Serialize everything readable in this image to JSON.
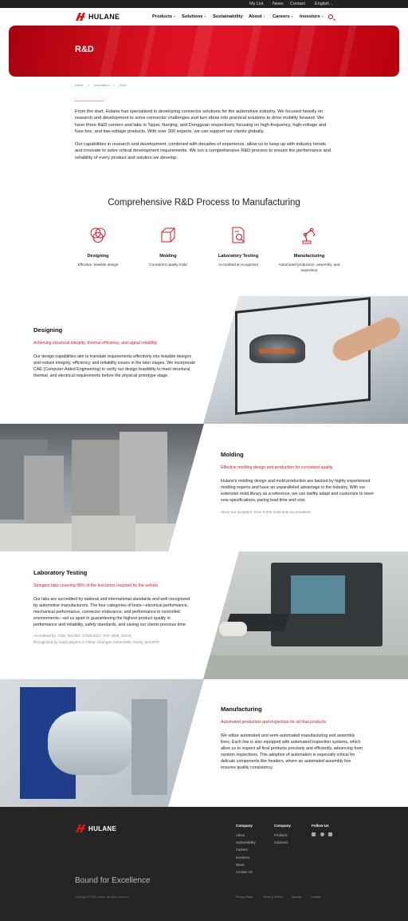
{
  "topbar": {
    "my_list": "My List",
    "news": "News",
    "contact": "Contact",
    "language": "English"
  },
  "header": {
    "logo": "HULANE",
    "nav": [
      "Products",
      "Solutions",
      "Sustainability",
      "About",
      "Careers",
      "Investors"
    ]
  },
  "hero": {
    "title": "R&D"
  },
  "breadcrumb": [
    "Home",
    "Innovation",
    "R&D"
  ],
  "intro": {
    "p1": "From the start, Hulane has specialized in developing connector solutions for the automotive industry. We focused heavily on research and development to solve connector challenges and turn ideas into practical solutions to drive mobility forward. We have three R&D centers and labs in Taipei, Nanjing, and Dongguan respectively focusing on high-frequency, high-voltage and fuse box, and low-voltage products. With over 300 experts, we can support our clients globally.",
    "p2": "Our capabilities in research and development, combined with decades of experience, allow us to keep up with industry trends and innovate to solve critical development requirements. We run a comprehensive R&D process to ensure the performance and reliability of every product and solution we develop."
  },
  "process": {
    "title": "Comprehensive R&D Process to Manufacturing",
    "steps": [
      {
        "name": "Designing",
        "desc": "Effective, feasible design",
        "icon": "circles-icon"
      },
      {
        "name": "Molding",
        "desc": "Consistent quality mold",
        "icon": "cube-icon"
      },
      {
        "name": "Laboratory Testing",
        "desc": "Accredited & recognized",
        "icon": "document-search-icon"
      },
      {
        "name": "Manufacturing",
        "desc": "Automated production, assembly, and inspection",
        "icon": "robot-arm-icon"
      }
    ]
  },
  "sections": {
    "designing": {
      "title": "Designing",
      "sub": "Achieving structural integrity, thermal efficiency, and signal reliability",
      "body": "Our design capabilities aim to translate requirements effectively into feasible designs and reduce integrity, efficiency, and reliability issues in the later stages. We incorporate CAE (Computer-Aided Engineering) to verify our design feasibility to meet structural, thermal, and electrical requirements before the physical prototype stage."
    },
    "molding": {
      "title": "Molding",
      "sub": "Effective molding design and production for consistent quality",
      "body": "Hulane's molding design and mold production are backed by highly experienced molding experts and have an unparalleled advantage in the industry. With our extensive mold library as a reference, we can swiftly adapt and customize to meet new specifications, paring lead time and cost.",
      "note": "Since our inception: Over 8,000 mold sets accumulated"
    },
    "testing": {
      "title": "Laboratory Testing",
      "sub": "Stringent labs covering 95% of the test items required by the vehicle",
      "body": "Our labs are accredited by national and international standards and well-recognized by automotive manufacturers. The four categories of tests—electrical performance, mechanical performance, connector endurance, and performance in controlled environments—set us apart in guaranteeing the highest product quality in performance and reliability, safety standards, and saving our clients precious time.",
      "note1": "Accredited by: CNS, ISO/IEC 17025:2017, TAF 3008, CNAS",
      "note2": "Recognized by major players in China: Changan Automobile, Geely, and BYD"
    },
    "manufacturing": {
      "title": "Manufacturing",
      "sub": "Automated production and inspection for all final products",
      "body": "We utilize automated and semi-automated manufacturing and assembly lines. Each line is also equipped with automated inspection systems, which allow us to inspect all final products precisely and efficiently, advancing from random inspections. This adoption of automation is especially critical for delicate components like headers, where an automated assembly line ensures quality consistency."
    }
  },
  "footer": {
    "logo": "HULANE",
    "col1": {
      "title": "Company",
      "links": [
        "About",
        "Sustainability",
        "Careers",
        "Investors",
        "News",
        "Contact Us"
      ]
    },
    "col2": {
      "title": "Company",
      "links": [
        "Products",
        "Solutions"
      ]
    },
    "col3": {
      "title": "Follow Us"
    },
    "slogan": "Bound for Excellence",
    "copyright": "Copyright © 2024 Hulane. All rights reserved.",
    "legal": [
      "Privacy Policy",
      "Terms of Service",
      "Sitemap",
      "Cookies"
    ]
  },
  "colors": {
    "accent": "#e0141e",
    "footer_bg": "#252525"
  }
}
